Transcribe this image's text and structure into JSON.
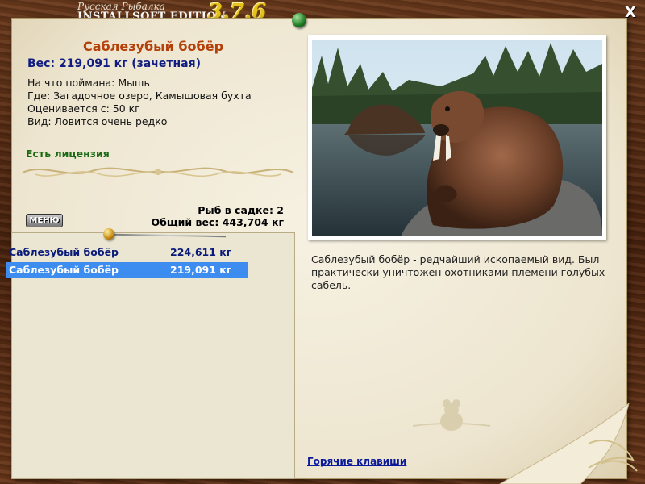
{
  "app": {
    "title_line1": "Русская Рыбалка",
    "title_line2": "INSTALLSOFT EDITION",
    "version": "3.7.6",
    "close": "X"
  },
  "fish": {
    "name": "Саблезубый бобёр",
    "weight": "Вес: 219,091 кг (зачетная)",
    "info": [
      "На что поймана: Мышь",
      "Где: Загадочное озеро, Камышовая бухта",
      "Оценивается с: 50 кг",
      "Вид: Ловится очень редко"
    ],
    "license": "Есть лицензия",
    "description": "Саблезубый бобёр - редчайший ископаемый вид. Был практически уничтожен охотниками племени голубых сабель."
  },
  "cage": {
    "count": "Рыб в садке: 2",
    "total": "Общий вес: 443,704 кг"
  },
  "menu_label": "МЕНЮ",
  "list": [
    {
      "name": "Саблезубый бобёр",
      "weight": "224,611 кг",
      "selected": false
    },
    {
      "name": "Саблезубый бобёр",
      "weight": "219,091 кг",
      "selected": true
    }
  ],
  "hotkeys": "Горячие клавиши",
  "colors": {
    "title": "#b4400a",
    "weight": "#101c80",
    "license": "#1a6a14",
    "selection": "#3d8cf0"
  },
  "icons": {
    "close": "close-icon",
    "pin": "pushpin-icon",
    "menu": "menu-button"
  }
}
